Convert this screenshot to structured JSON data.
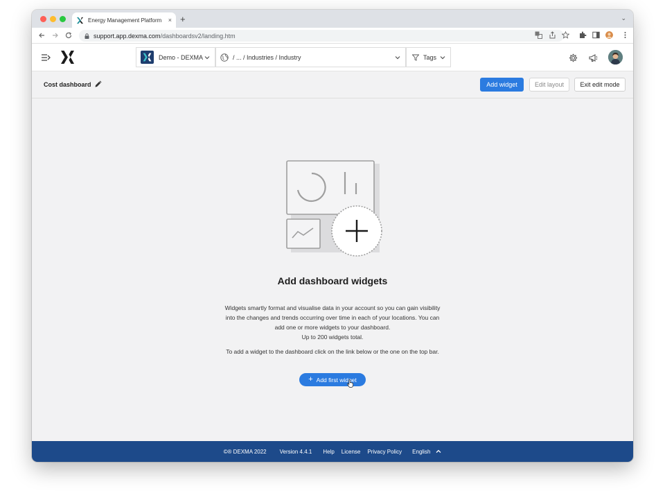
{
  "browser": {
    "tab_title": "Energy Management Platform",
    "tab_close": "×",
    "new_tab": "+",
    "tab_menu": "⌄",
    "url_host": "support.app.dexma.com",
    "url_path": "/dashboardsv2/landing.htm"
  },
  "header": {
    "org_name": "Demo - DEXMA",
    "location_path": "/ ... / Industries / Industry",
    "tags_label": "Tags"
  },
  "dashboard": {
    "title": "Cost dashboard",
    "add_widget_label": "Add widget",
    "edit_layout_label": "Edit layout",
    "exit_edit_label": "Exit edit mode"
  },
  "empty_state": {
    "heading": "Add dashboard widgets",
    "description": "Widgets smartly format and visualise data in your account so you can gain visibility into the changes and trends occurring over time in each of your locations. You can add one or more widgets to your dashboard.",
    "limit": "Up to 200 widgets total.",
    "instruction": "To add a widget to the dashboard click on the link below or the one on the top bar.",
    "button_plus": "+",
    "button_label": "Add first widget"
  },
  "footer": {
    "copyright": "©® DEXMA 2022",
    "version": "Version 4.4.1",
    "help": "Help",
    "license": "License",
    "privacy": "Privacy Policy",
    "language": "English"
  },
  "colors": {
    "primary": "#2b7be0",
    "footer": "#1d4a8a",
    "org_logo": "#1e3d6e"
  },
  "icons": [
    "hamburger-icon",
    "dexma-logo",
    "globe-icon",
    "filter-icon",
    "gear-icon",
    "megaphone-icon",
    "pencil-icon",
    "plus-icon",
    "chevron-up-icon"
  ]
}
